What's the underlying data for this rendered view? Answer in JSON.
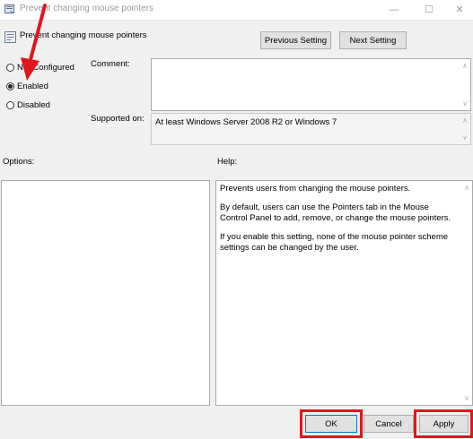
{
  "window": {
    "title": "Prevent changing mouse pointers",
    "minimize_glyph": "—",
    "maximize_glyph": "☐",
    "close_glyph": "✕"
  },
  "header": {
    "policy_name": "Prevent changing mouse pointers",
    "prev_button": "Previous Setting",
    "next_button": "Next Setting"
  },
  "state": {
    "options": [
      "Not Configured",
      "Enabled",
      "Disabled"
    ],
    "selected": "Enabled"
  },
  "comment": {
    "label": "Comment:",
    "value": ""
  },
  "supported": {
    "label": "Supported on:",
    "value": "At least Windows Server 2008 R2 or Windows 7"
  },
  "options_panel": {
    "label": "Options:"
  },
  "help_panel": {
    "label": "Help:",
    "paragraphs": [
      "Prevents users from changing the mouse pointers.",
      "By default, users can use the Pointers tab in the Mouse Control Panel to add, remove, or change the mouse pointers.",
      "If you enable this setting, none of the mouse pointer scheme settings can be changed by the user."
    ]
  },
  "footer": {
    "ok": "OK",
    "cancel": "Cancel",
    "apply": "Apply"
  },
  "annotation": {
    "color": "#e0161e"
  }
}
